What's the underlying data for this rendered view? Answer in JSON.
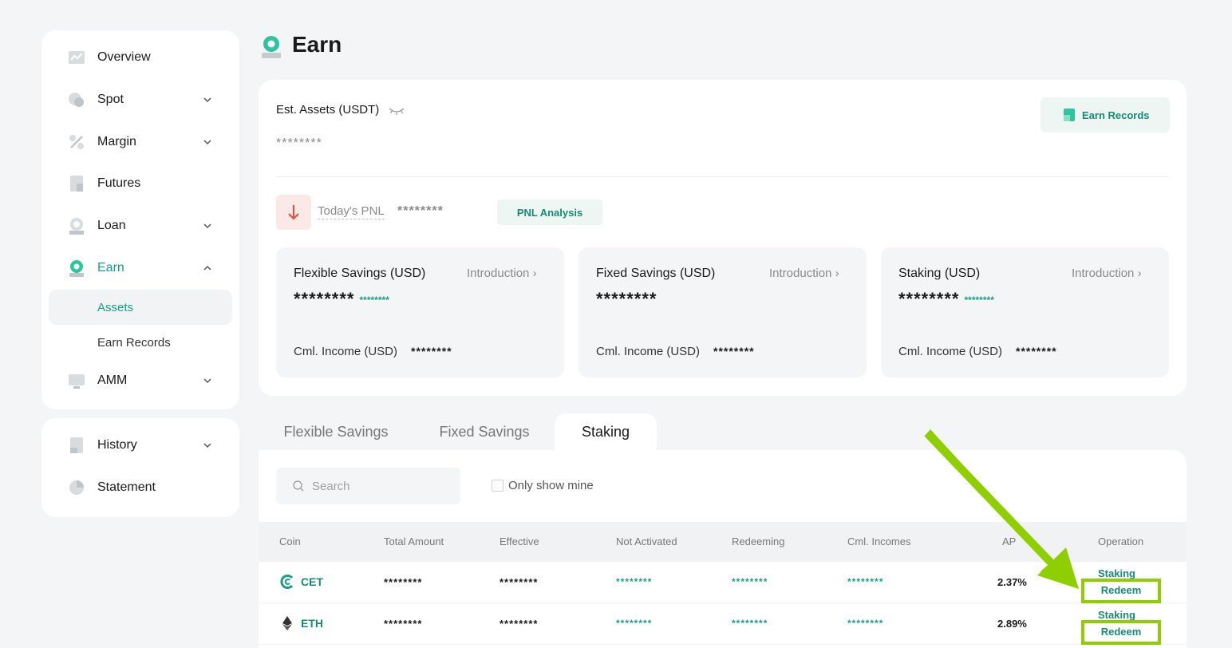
{
  "sidebar": {
    "items": [
      {
        "label": "Overview"
      },
      {
        "label": "Spot"
      },
      {
        "label": "Margin"
      },
      {
        "label": "Futures"
      },
      {
        "label": "Loan"
      },
      {
        "label": "Earn"
      },
      {
        "label": "AMM"
      }
    ],
    "earn_sub": [
      {
        "label": "Assets"
      },
      {
        "label": "Earn Records"
      }
    ],
    "bottom": [
      {
        "label": "History"
      },
      {
        "label": "Statement"
      }
    ]
  },
  "page": {
    "title": "Earn"
  },
  "assets": {
    "est_label": "Est. Assets (USDT)",
    "est_value": "********",
    "earn_records_label": "Earn Records",
    "pnl_label": "Today's PNL",
    "pnl_value": "********",
    "pnl_button": "PNL Analysis",
    "cards": [
      {
        "title": "Flexible Savings (USD)",
        "intro": "Introduction",
        "value": "********",
        "small": "********",
        "cml_label": "Cml. Income (USD)",
        "cml_value": "********"
      },
      {
        "title": "Fixed Savings (USD)",
        "intro": "Introduction",
        "value": "********",
        "small": "",
        "cml_label": "Cml. Income (USD)",
        "cml_value": "********"
      },
      {
        "title": "Staking (USD)",
        "intro": "Introduction",
        "value": "********",
        "small": "********",
        "cml_label": "Cml. Income (USD)",
        "cml_value": "********"
      }
    ]
  },
  "tabs": [
    {
      "label": "Flexible Savings"
    },
    {
      "label": "Fixed Savings"
    },
    {
      "label": "Staking"
    }
  ],
  "table": {
    "search_placeholder": "Search",
    "only_mine_label": "Only show mine",
    "columns": [
      "Coin",
      "Total Amount",
      "Effective",
      "Not Activated",
      "Redeeming",
      "Cml. Incomes",
      "AP",
      "Operation"
    ],
    "rows": [
      {
        "coin": "CET",
        "total": "********",
        "effective": "********",
        "not_activated": "********",
        "redeeming": "********",
        "cml": "********",
        "apy": "2.37%",
        "op1": "Staking",
        "op2": "Redeem"
      },
      {
        "coin": "ETH",
        "total": "********",
        "effective": "********",
        "not_activated": "********",
        "redeeming": "********",
        "cml": "********",
        "apy": "2.89%",
        "op1": "Staking",
        "op2": "Redeem"
      }
    ]
  },
  "colors": {
    "accent": "#16a085",
    "highlight": "#8fce00",
    "loss": "#e74c3c"
  }
}
